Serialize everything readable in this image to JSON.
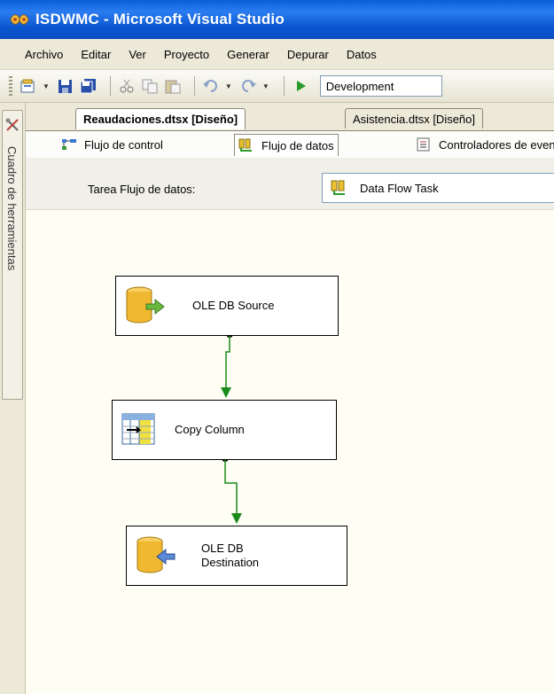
{
  "window": {
    "title": "ISDWMC - Microsoft Visual Studio"
  },
  "menu": {
    "items": [
      "Archivo",
      "Editar",
      "Ver",
      "Proyecto",
      "Generar",
      "Depurar",
      "Datos"
    ]
  },
  "toolbar": {
    "configuration": "Development"
  },
  "toolbox": {
    "label": "Cuadro de herramientas"
  },
  "document_tabs": [
    {
      "label": "Reaudaciones.dtsx [Diseño]",
      "active": true
    },
    {
      "label": "Asistencia.dtsx [Diseño]",
      "active": false
    }
  ],
  "designer_tabs": [
    {
      "label": "Flujo de control",
      "active": false
    },
    {
      "label": "Flujo de datos",
      "active": true
    },
    {
      "label": "Controladores de eventos",
      "active": false
    }
  ],
  "task": {
    "label": "Tarea Flujo de datos:",
    "value": "Data Flow Task"
  },
  "nodes": [
    {
      "label": "OLE DB Source",
      "kind": "source"
    },
    {
      "label": "Copy Column",
      "kind": "transform"
    },
    {
      "label_line1": "OLE DB",
      "label_line2": "Destination",
      "kind": "destination"
    }
  ]
}
